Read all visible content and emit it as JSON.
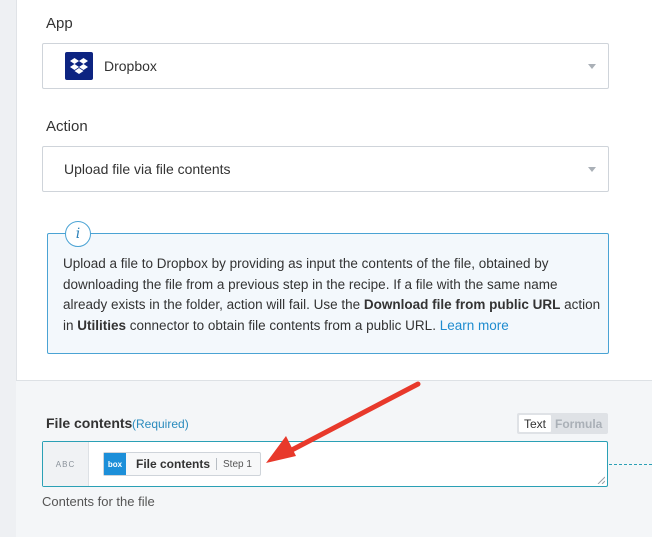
{
  "app": {
    "label": "App",
    "selected": "Dropbox",
    "icon": "dropbox-icon"
  },
  "action": {
    "label": "Action",
    "selected": "Upload file via file contents"
  },
  "info": {
    "icon": "i",
    "text_1": "Upload a file to Dropbox by providing as input the contents of the file, obtained by downloading the file from a previous step in the recipe. If a file with the same name already exists in the folder, action will fail. Use the ",
    "bold_1": "Download file from public URL",
    "text_2": " action in ",
    "bold_2": "Utilities",
    "text_3": " connector to obtain file contents from a public URL. ",
    "link": "Learn more"
  },
  "file_contents": {
    "label": "File contents",
    "required": "(Required)",
    "toggle_text": "Text",
    "toggle_formula": "Formula",
    "type_badge": "ABC",
    "pill_icon_text": "box",
    "pill_label": "File contents",
    "pill_step": "Step 1",
    "hint": "Contents for the file"
  },
  "colors": {
    "accent": "#2aa0b5",
    "info_border": "#4aa3d4",
    "link": "#1f8ccf",
    "dropbox_bg": "#0d2481",
    "box_bg": "#1c8fd9",
    "arrow": "#e8392b"
  }
}
